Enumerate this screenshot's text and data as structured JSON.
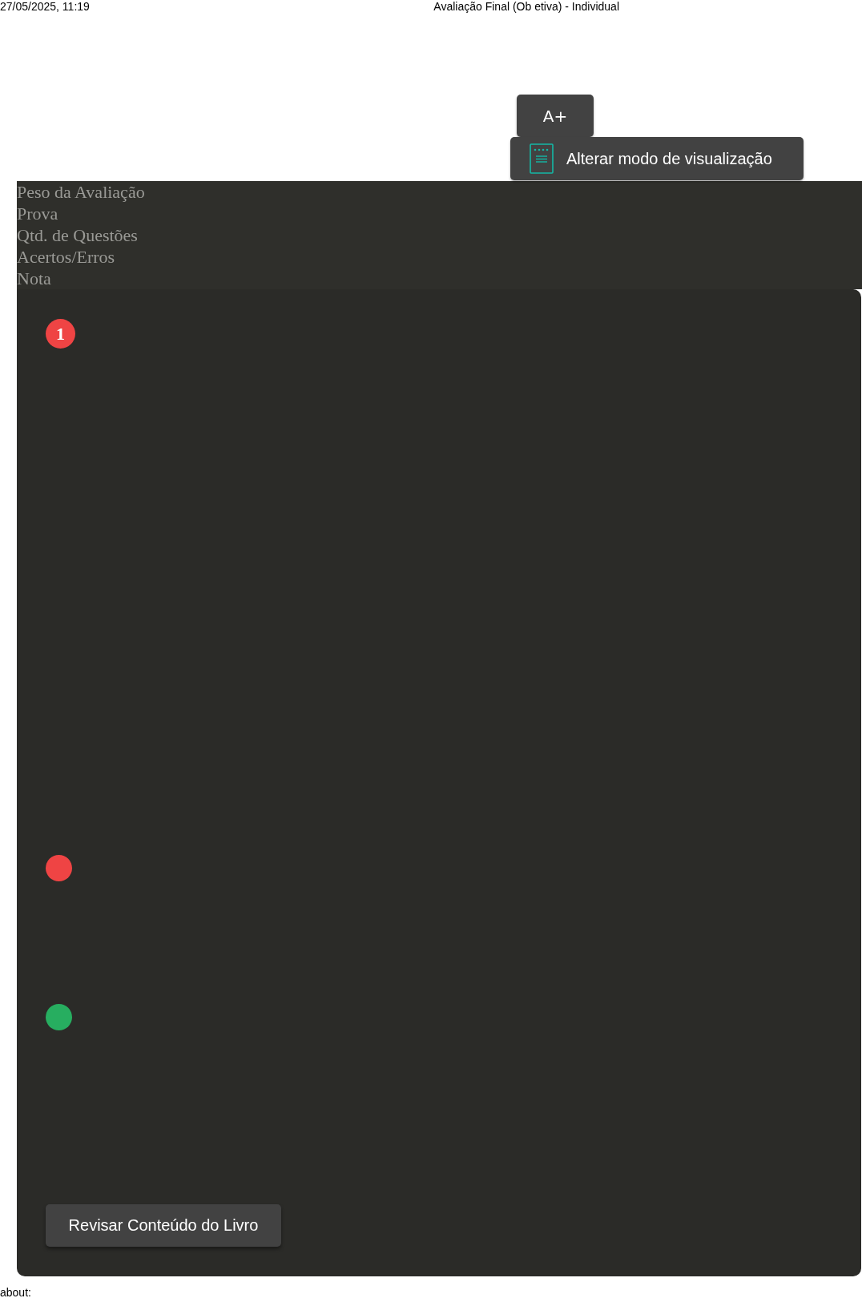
{
  "print_header": {
    "date": "27/05/2025, 11:19",
    "title": "Avaliação Final (Ob etiva) - Individual"
  },
  "toolbar": {
    "font_button": "A+",
    "view_mode_button": "Alterar modo de visualização"
  },
  "summary_labels": [
    "Peso da Avaliação",
    "Prova",
    "Qtd. de Questões",
    "Acertos/Erros",
    "Nota"
  ],
  "question": {
    "number": "1",
    "color": "#ef4444"
  },
  "answer_markers": [
    {
      "color": "#ef4444"
    },
    {
      "color": "#27ae60"
    }
  ],
  "review_button": "Revisar Conteúdo do Livro",
  "print_footer": "about:"
}
